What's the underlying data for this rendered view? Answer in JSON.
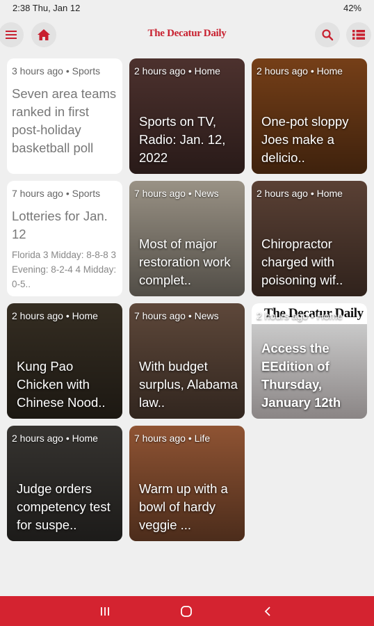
{
  "status_bar": {
    "time_date": "2:38   Thu, Jan 12",
    "right": "42%"
  },
  "app_bar": {
    "logo": "The Decatur Daily"
  },
  "cards": [
    {
      "meta": "3 hours ago • Sports",
      "title": "Seven area teams ranked in first post-holiday basketball poll",
      "kind": "text"
    },
    {
      "meta": "2 hours ago • Home",
      "title": "Sports on TV, Radio: Jan. 12, 2022",
      "kind": "image",
      "bg": "#5a3a36"
    },
    {
      "meta": "2 hours ago • Home",
      "title": "One-pot sloppy Joes make a delicio..",
      "kind": "image",
      "bg": "#8a4a1c"
    },
    {
      "meta": "7 hours ago • Sports",
      "title": "Lotteries for Jan. 12",
      "subtitle": "Florida 3 Midday: 8-8-8 3 Evening: 8-2-4 4 Midday: 0-5..",
      "kind": "text"
    },
    {
      "meta": "7 hours ago • News",
      "title": "Most of major restoration work complet..",
      "kind": "image",
      "bg": "#b4ab9c"
    },
    {
      "meta": "2 hours ago • Home",
      "title": "Chiropractor charged with poisoning wif..",
      "kind": "image",
      "bg": "#6a4c3e"
    },
    {
      "meta": "2 hours ago • Home",
      "title": "Kung Pao Chicken with Chinese Nood..",
      "kind": "image",
      "bg": "#3e3528"
    },
    {
      "meta": "7 hours ago • News",
      "title": "With budget surplus, Alabama law..",
      "kind": "image",
      "bg": "#6e5444"
    },
    {
      "meta": "2 hours ago • Home",
      "title": "Access the EEdition of Thursday, January 12th",
      "kind": "image",
      "bg": "#d9d9d9",
      "masthead": "The Decatur Daily"
    },
    {
      "meta": "2 hours ago • Home",
      "title": "Judge orders competency test for suspe..",
      "kind": "image",
      "bg": "#3f3c38"
    },
    {
      "meta": "7 hours ago • Life",
      "title": "Warm up with a bowl of hardy veggie ...",
      "kind": "image",
      "bg": "#a8623c"
    }
  ]
}
